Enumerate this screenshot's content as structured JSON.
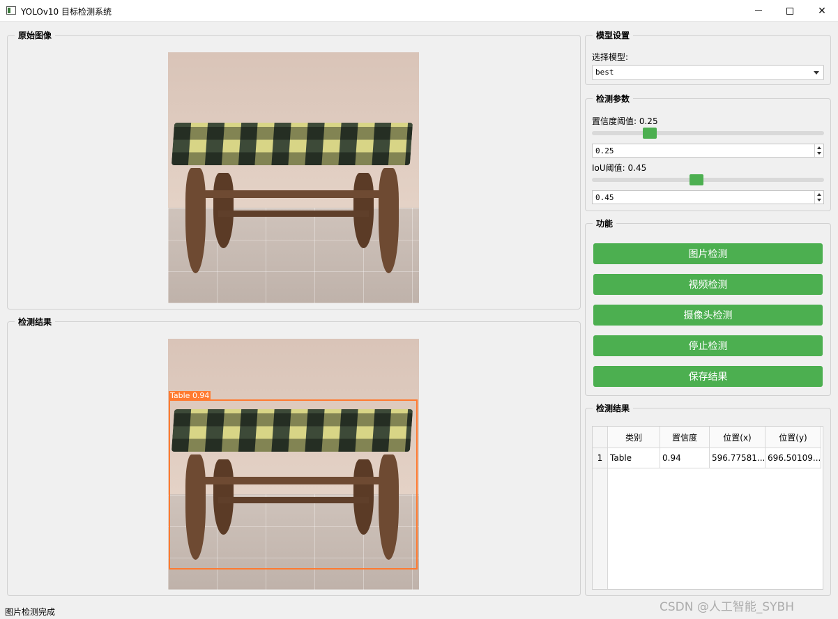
{
  "window": {
    "title": "YOLOv10 目标检测系统",
    "minimize": "—",
    "maximize": "☐",
    "close": "✕"
  },
  "original_panel": {
    "title": "原始图像"
  },
  "result_panel": {
    "title": "检测结果",
    "detection": {
      "label": "Table 0.94",
      "color": "#ff7a30"
    }
  },
  "model_settings": {
    "title": "模型设置",
    "select_label": "选择模型:",
    "selected_model": "best"
  },
  "detect_params": {
    "title": "检测参数",
    "confidence": {
      "label": "置信度阈值: 0.25",
      "value": "0.25",
      "level": 0.25
    },
    "iou": {
      "label": "IoU阈值: 0.45",
      "value": "0.45",
      "level": 0.45
    }
  },
  "functions": {
    "title": "功能",
    "buttons": [
      "图片检测",
      "视频检测",
      "摄像头检测",
      "停止检测",
      "保存结果"
    ],
    "accent": "#4caf50"
  },
  "results_table": {
    "title": "检测结果",
    "headers": [
      "类别",
      "置信度",
      "位置(x)",
      "位置(y)"
    ],
    "rows": [
      {
        "num": "1",
        "cells": [
          "Table",
          "0.94",
          "596.77581...",
          "696.50109..."
        ]
      }
    ]
  },
  "status": {
    "text": "图片检测完成"
  },
  "watermark": "CSDN @人工智能_SYBH"
}
